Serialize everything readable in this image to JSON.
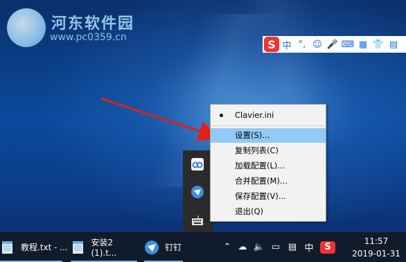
{
  "watermark": {
    "site_name": "河东软件园",
    "url": "www.pc0359.cn"
  },
  "ime_toolbar": {
    "logo": "S",
    "items": [
      {
        "label": "中",
        "icon": "chinese-mode-icon"
      },
      {
        "label": "°,",
        "icon": "punctuation-icon"
      },
      {
        "label": "☺",
        "icon": "emoji-icon"
      },
      {
        "label": "🎤",
        "icon": "microphone-icon"
      },
      {
        "label": "⌨",
        "icon": "keyboard-icon"
      },
      {
        "label": "▦",
        "icon": "toolbox-icon"
      },
      {
        "label": "👕",
        "icon": "skin-icon"
      },
      {
        "label": "▤",
        "icon": "grid-menu-icon"
      }
    ]
  },
  "context_menu": {
    "header": "Clavier.ini",
    "items": [
      "设置(S)...",
      "复制列表(C)",
      "加载配置(L)...",
      "合并配置(M)...",
      "保存配置(V)...",
      "退出(Q)"
    ],
    "highlight_color": "#91c9f7"
  },
  "taskbar": {
    "items": [
      {
        "label": "教程.txt - ...",
        "icon": "notepad-icon"
      },
      {
        "label": "安装2 (1).t...",
        "icon": "notepad-icon"
      },
      {
        "label": "钉钉",
        "icon": "dingtalk-icon"
      }
    ],
    "tray": {
      "ime_mode": "中",
      "clock_time": "11:57",
      "clock_date": "2019-01-31"
    }
  },
  "colors": {
    "arrow": "#e0201a",
    "taskbar": "#101b2b",
    "sogou_red": "#e33333"
  }
}
